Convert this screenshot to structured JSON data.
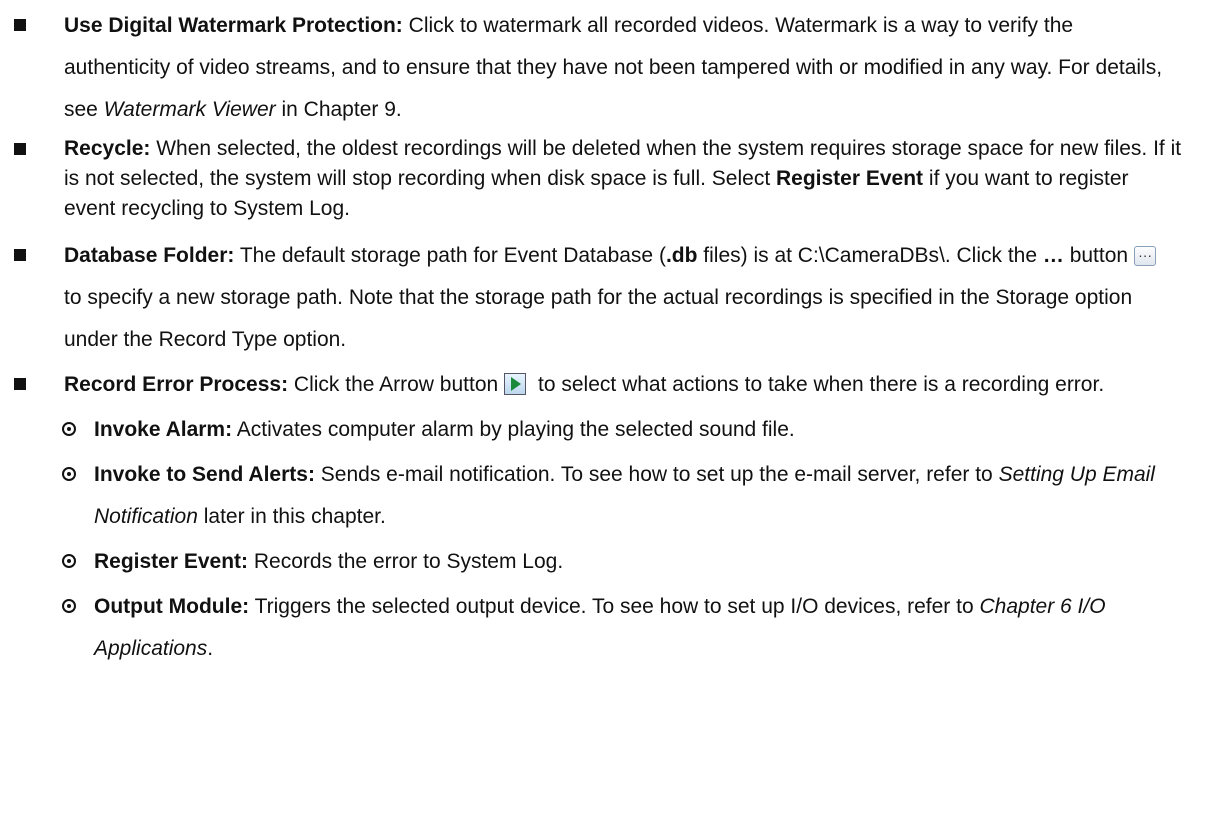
{
  "items": [
    {
      "label": "Use Digital Watermark Protection:",
      "t1": " Click to watermark all recorded videos. Watermark is a way to verify the authenticity of video streams, and to ensure that they have not been tampered with or modified in any way. For details, see ",
      "ref": "Watermark Viewer",
      "t2": " in Chapter 9."
    },
    {
      "label": "Recycle:",
      "t1": " When selected, the oldest recordings will be deleted when the system requires storage space for new files. If it is not selected, the system will stop recording when disk space is full. Select ",
      "bold": "Register Event",
      "t2": " if you want to register event recycling to System Log."
    },
    {
      "label": "Database Folder:",
      "t1": " The default storage path for Event Database (",
      "bold": ".db",
      "t2": " files) is at C:\\CameraDBs\\. Click the ",
      "bold2": "…",
      "t3": " button",
      "t4": " to specify a new storage path. Note that the storage path for the actual recordings is specified in the Storage option under the Record Type option."
    },
    {
      "label": "Record Error Process:",
      "t1": " Click the Arrow button",
      "t2": " to select what actions to take when there is a recording error."
    }
  ],
  "subitems": [
    {
      "label": "Invoke Alarm:",
      "t1": " Activates computer alarm by playing the selected sound file."
    },
    {
      "label": "Invoke to Send Alerts:",
      "t1": " Sends e-mail notification. To see how to set up the e-mail server, refer to ",
      "ref": "Setting Up Email Notification",
      "t2": " later in this chapter."
    },
    {
      "label": "Register Event:",
      "t1": " Records the error to System Log."
    },
    {
      "label": "Output Module:",
      "t1": " Triggers the selected output device. To see how to set up I/O devices, refer to ",
      "ref": "Chapter 6 I/O Applications",
      "t2": "."
    }
  ]
}
